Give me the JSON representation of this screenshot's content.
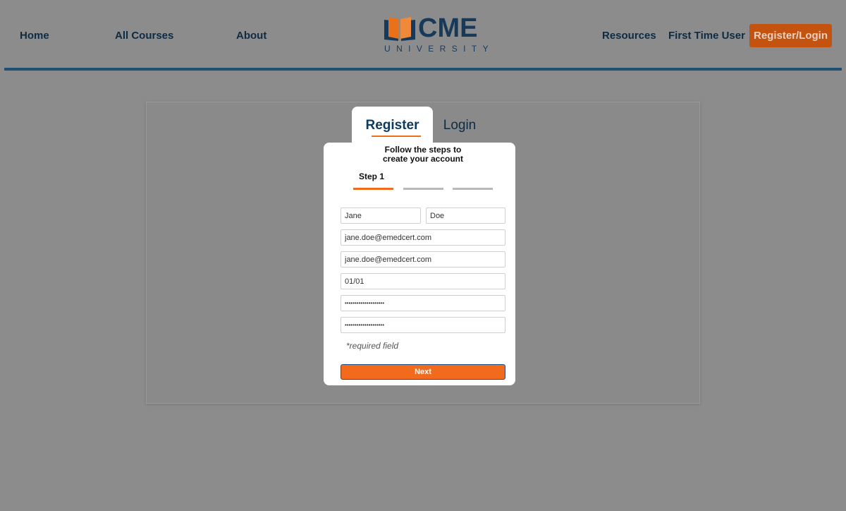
{
  "nav": {
    "home": "Home",
    "all_courses": "All Courses",
    "about": "About",
    "resources": "Resources",
    "first_time_user": "First Time User",
    "register_login": "Register/Login"
  },
  "logo": {
    "title": "CME",
    "subtitle": "UNIVERSITY",
    "colors": {
      "navy": "#183a5a",
      "orange": "#e8711a"
    }
  },
  "tabs": {
    "register": "Register",
    "login": "Login"
  },
  "form": {
    "title": "Follow the steps to create your account",
    "step_label": "Step 1",
    "first_name": "Jane",
    "last_name": "Doe",
    "email": "jane.doe@emedcert.com",
    "email_confirm": "jane.doe@emedcert.com",
    "birthdate": "01/01",
    "password": "••••••••••••••••••••",
    "password_confirm": "••••••••••••••••••••",
    "required_note": "*required field",
    "next_label": "Next"
  },
  "colors": {
    "accent": "#f26a1b",
    "brand": "#0e3a5f",
    "divider": "#1f4f72"
  }
}
